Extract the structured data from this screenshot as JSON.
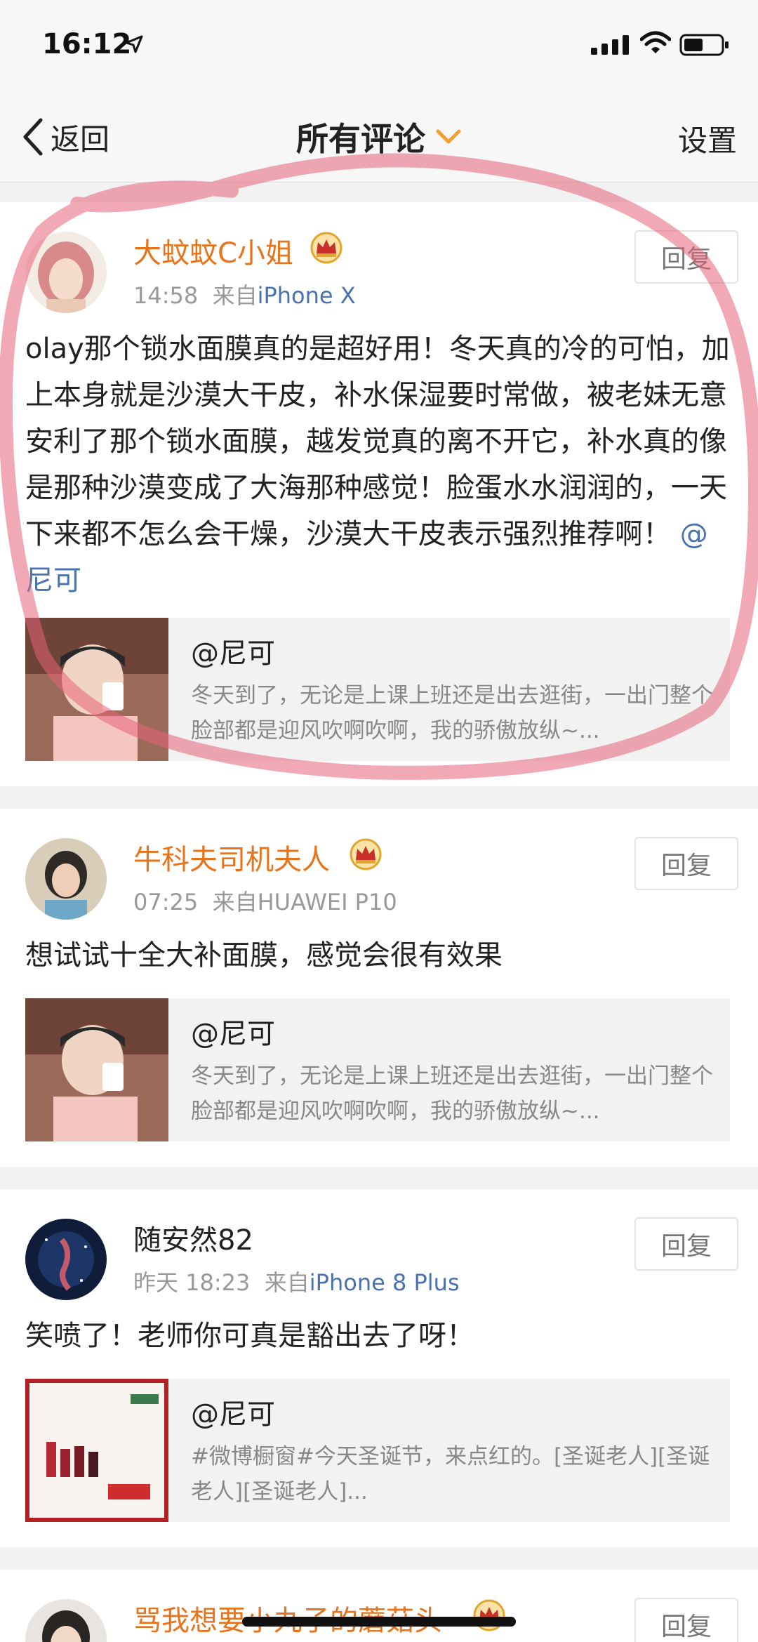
{
  "status": {
    "time": "16:12"
  },
  "nav": {
    "back_label": "返回",
    "title": "所有评论",
    "settings_label": "设置"
  },
  "comments": [
    {
      "username": "大蚊蚊C小姐",
      "time": "14:58",
      "source_prefix": "来自",
      "device": "iPhone X",
      "reply_label": "回复",
      "text": "olay那个锁水面膜真的是超好用！冬天真的冷的可怕，加上本身就是沙漠大干皮，补水保湿要时常做，被老妹无意安利了那个锁水面膜，越发觉真的离不开它，补水真的像是那种沙漠变成了大海那种感觉！脸蛋水水润润的，一天下来都不怎么会干燥，沙漠大干皮表示强烈推荐啊！",
      "mention": "@尼可",
      "quote": {
        "author": "@尼可",
        "text": "冬天到了，无论是上课上班还是出去逛街，一出门整个脸部都是迎风吹啊吹啊，我的骄傲放纵~..."
      }
    },
    {
      "username": "牛科夫司机夫人",
      "time": "07:25",
      "source_prefix": "来自",
      "device": "HUAWEI P10",
      "reply_label": "回复",
      "text": "想试试十全大补面膜，感觉会很有效果",
      "quote": {
        "author": "@尼可",
        "text": "冬天到了，无论是上课上班还是出去逛街，一出门整个脸部都是迎风吹啊吹啊，我的骄傲放纵~..."
      }
    },
    {
      "username": "随安然82",
      "time": "昨天 18:23",
      "source_prefix": "来自",
      "device": "iPhone 8 Plus",
      "reply_label": "回复",
      "text": "笑喷了！老师你可真是豁出去了呀！",
      "quote": {
        "author": "@尼可",
        "text": "#微博橱窗#今天圣诞节，来点红的。[圣诞老人][圣诞老人][圣诞老人]..."
      }
    },
    {
      "username": "骂我想要小丸子的蘑菇头",
      "reply_label": "回复"
    }
  ],
  "colors": {
    "vip_name": "#e8731a",
    "link": "#4a72b0",
    "meta": "#999999"
  }
}
